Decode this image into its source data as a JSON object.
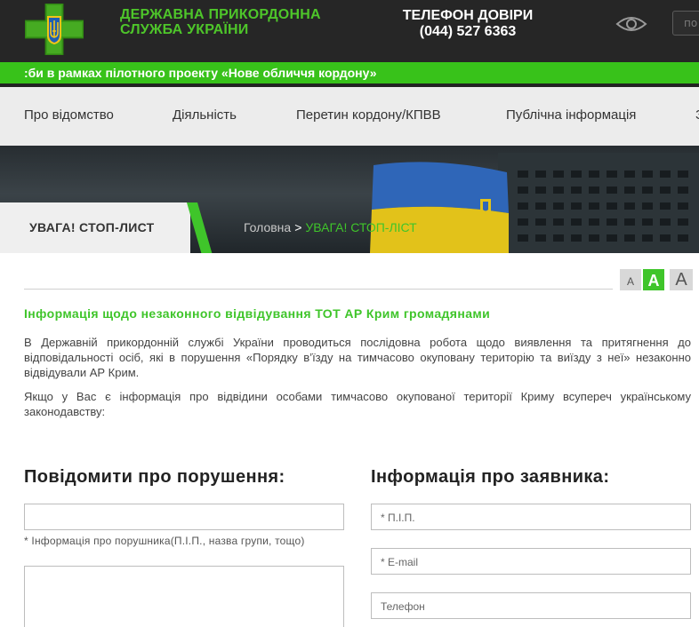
{
  "header": {
    "org_name_line1": "ДЕРЖАВНА ПРИКОРДОННА",
    "org_name_line2": "СЛУЖБА УКРАЇНИ",
    "hotline_title": "ТЕЛЕФОН ДОВІРИ",
    "hotline_number": "(044) 527 6363",
    "accessibility_icon": "eye-icon",
    "search_placeholder": "по"
  },
  "ticker": {
    "text": ":би в рамках пілотного проекту «Нове обличчя кордону»"
  },
  "nav": {
    "items": [
      "Про відомство",
      "Діяльність",
      "Перетин кордону/КПВВ",
      "Публічна інформація",
      "З"
    ]
  },
  "banner": {
    "page_title": "УВАГА! СТОП-ЛИСТ",
    "breadcrumb_home": "Головна",
    "breadcrumb_separator": ">",
    "breadcrumb_current": "УВАГА! СТОП-ЛІСТ"
  },
  "font_controls": {
    "small": "A",
    "medium": "A",
    "large": "A",
    "active": "medium"
  },
  "content": {
    "heading": "Інформація щодо незаконного відвідування ТОТ АР Крим громадянами",
    "paragraph1": "В Державній прикордонній службі України проводиться послідовна робота щодо виявлення та притягнення до відповідальності осіб, які в порушення «Порядку в’їзду на тимчасово окуповану територію та виїзду з неї» незаконно відвідували АР Крим.",
    "paragraph2": "Якщо у Вас є інформація про відвідини особами тимчасово окупованої території Криму всупереч українському законодавству:"
  },
  "form": {
    "report_heading": "Повідомити про порушення:",
    "applicant_heading": "Інформація про заявника:",
    "violator_value": "",
    "violator_hint": "* Інформація про порушника(П.І.П., назва групи, тощо)",
    "description_value": "",
    "name_placeholder": "* П.І.П.",
    "email_placeholder": "* E-mail",
    "phone_placeholder": "Телефон"
  },
  "colors": {
    "brand_green": "#3fc52a",
    "header_bg": "#262626",
    "nav_bg": "#ececec"
  }
}
